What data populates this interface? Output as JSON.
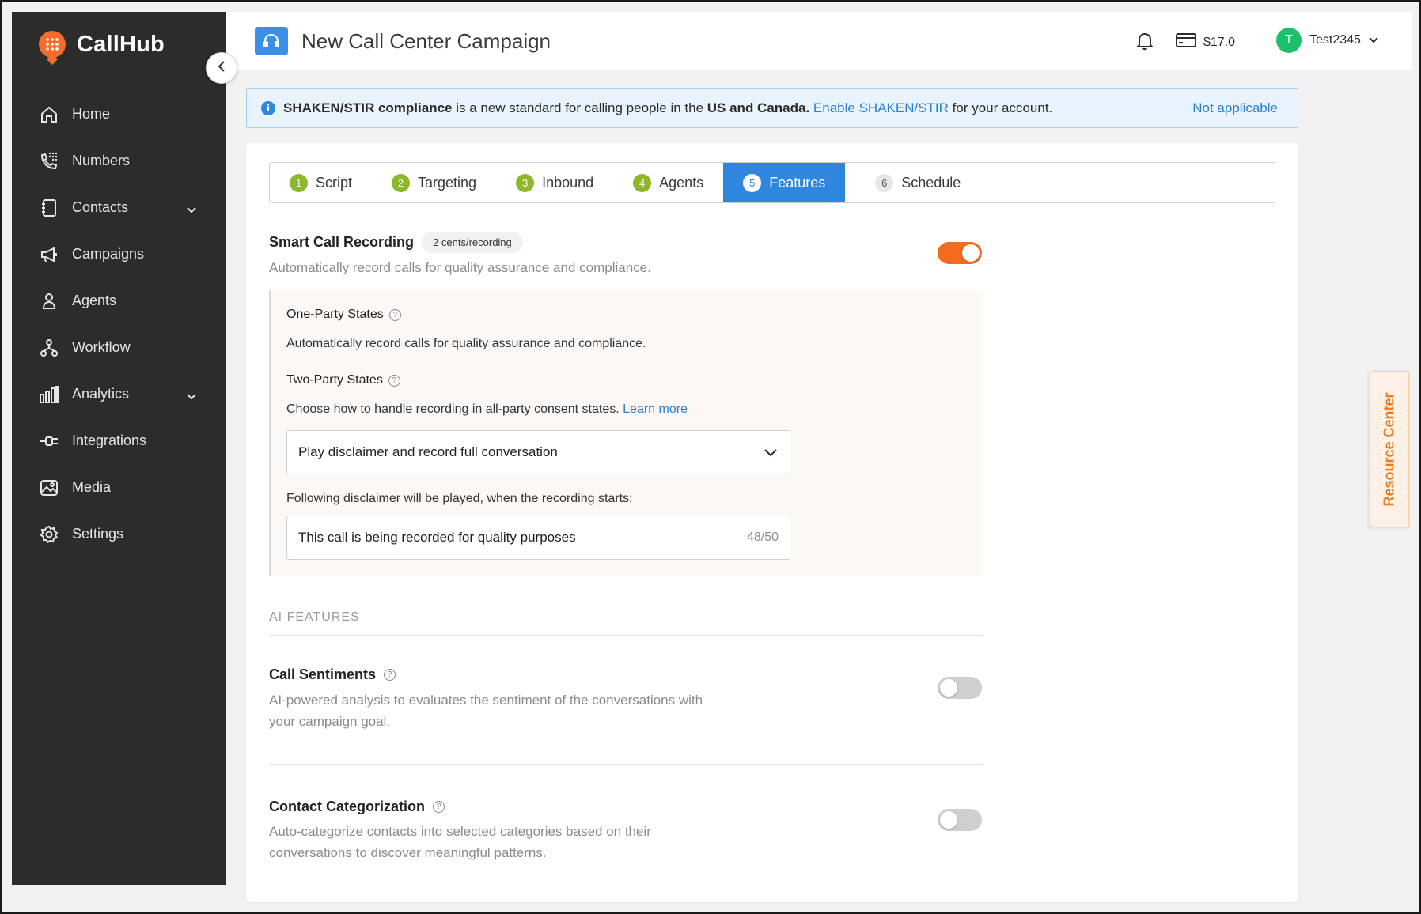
{
  "app": {
    "name": "CallHub"
  },
  "sidebar": {
    "items": [
      {
        "label": "Home",
        "icon": "home-icon"
      },
      {
        "label": "Numbers",
        "icon": "phone-keypad-icon"
      },
      {
        "label": "Contacts",
        "icon": "contacts-book-icon",
        "expandable": true
      },
      {
        "label": "Campaigns",
        "icon": "megaphone-icon"
      },
      {
        "label": "Agents",
        "icon": "person-icon"
      },
      {
        "label": "Workflow",
        "icon": "workflow-icon"
      },
      {
        "label": "Analytics",
        "icon": "bar-chart-icon",
        "expandable": true
      },
      {
        "label": "Integrations",
        "icon": "plug-icon"
      },
      {
        "label": "Media",
        "icon": "image-icon"
      },
      {
        "label": "Settings",
        "icon": "gear-icon"
      }
    ]
  },
  "header": {
    "title": "New Call Center Campaign",
    "balance": "$17.0",
    "user": {
      "initial": "T",
      "name": "Test2345"
    }
  },
  "banner": {
    "bold1": "SHAKEN/STIR compliance",
    "text1": " is a new standard for calling people in the ",
    "bold2": "US and Canada.",
    "link": "Enable SHAKEN/STIR",
    "text2": " for your account.",
    "action": "Not applicable"
  },
  "tabs": [
    {
      "num": "1",
      "label": "Script",
      "state": "done"
    },
    {
      "num": "2",
      "label": "Targeting",
      "state": "done"
    },
    {
      "num": "3",
      "label": "Inbound",
      "state": "done"
    },
    {
      "num": "4",
      "label": "Agents",
      "state": "done"
    },
    {
      "num": "5",
      "label": "Features",
      "state": "active"
    },
    {
      "num": "6",
      "label": "Schedule",
      "state": "pending"
    }
  ],
  "recording": {
    "title": "Smart Call Recording",
    "price": "2 cents/recording",
    "description": "Automatically record calls for quality assurance and compliance.",
    "enabled": true,
    "one_party_label": "One-Party States",
    "one_party_text": "Automatically record calls for quality assurance and compliance.",
    "two_party_label": "Two-Party States",
    "two_party_text": "Choose how to handle recording in all-party consent states.",
    "learn_more": "Learn more",
    "select_value": "Play disclaimer and record full conversation",
    "disclaimer_label": "Following disclaimer will be played, when the recording starts:",
    "disclaimer_value": "This call is being recorded for quality purposes",
    "disclaimer_count": "48/50"
  },
  "ai": {
    "heading": "AI FEATURES",
    "sentiments": {
      "title": "Call Sentiments",
      "line1": "AI-powered analysis to evaluates the sentiment of the conversations with",
      "line2": "your campaign goal.",
      "enabled": false
    },
    "categorization": {
      "title": "Contact Categorization",
      "line1": "Auto-categorize contacts into selected categories based on their",
      "line2": "conversations to discover meaningful patterns.",
      "enabled": false
    }
  },
  "resource_center": "Resource Center",
  "colors": {
    "accent": "#2f86de",
    "brand": "#f36c2b",
    "toggle_on": "#f36c1e",
    "step_done": "#8db82c"
  }
}
